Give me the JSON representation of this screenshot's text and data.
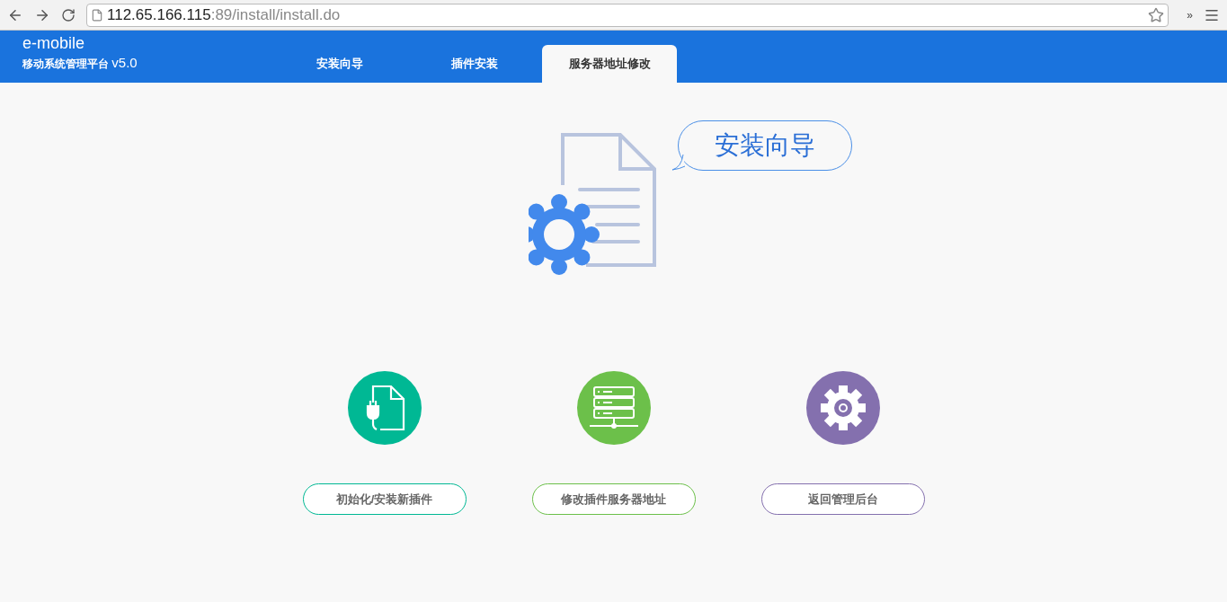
{
  "browser": {
    "url": {
      "host": "112.65.166.115",
      "path": ":89/install/install.do"
    },
    "overflow": "»"
  },
  "header": {
    "app_name": "e-mobile",
    "subtitle": "移动系统管理平台",
    "version": "v5.0"
  },
  "tabs": [
    {
      "label": "安装向导",
      "selected": false
    },
    {
      "label": "插件安装",
      "selected": false
    },
    {
      "label": "服务器地址修改",
      "selected": true
    }
  ],
  "hero": {
    "bubble": "安装向导"
  },
  "actions": [
    {
      "kind": "plugin",
      "color": "#00b894",
      "label": "初始化/安装新插件"
    },
    {
      "kind": "server",
      "color": "#6cc04a",
      "label": "修改插件服务器地址"
    },
    {
      "kind": "gear",
      "color": "#8470ae",
      "label": "返回管理后台"
    }
  ]
}
